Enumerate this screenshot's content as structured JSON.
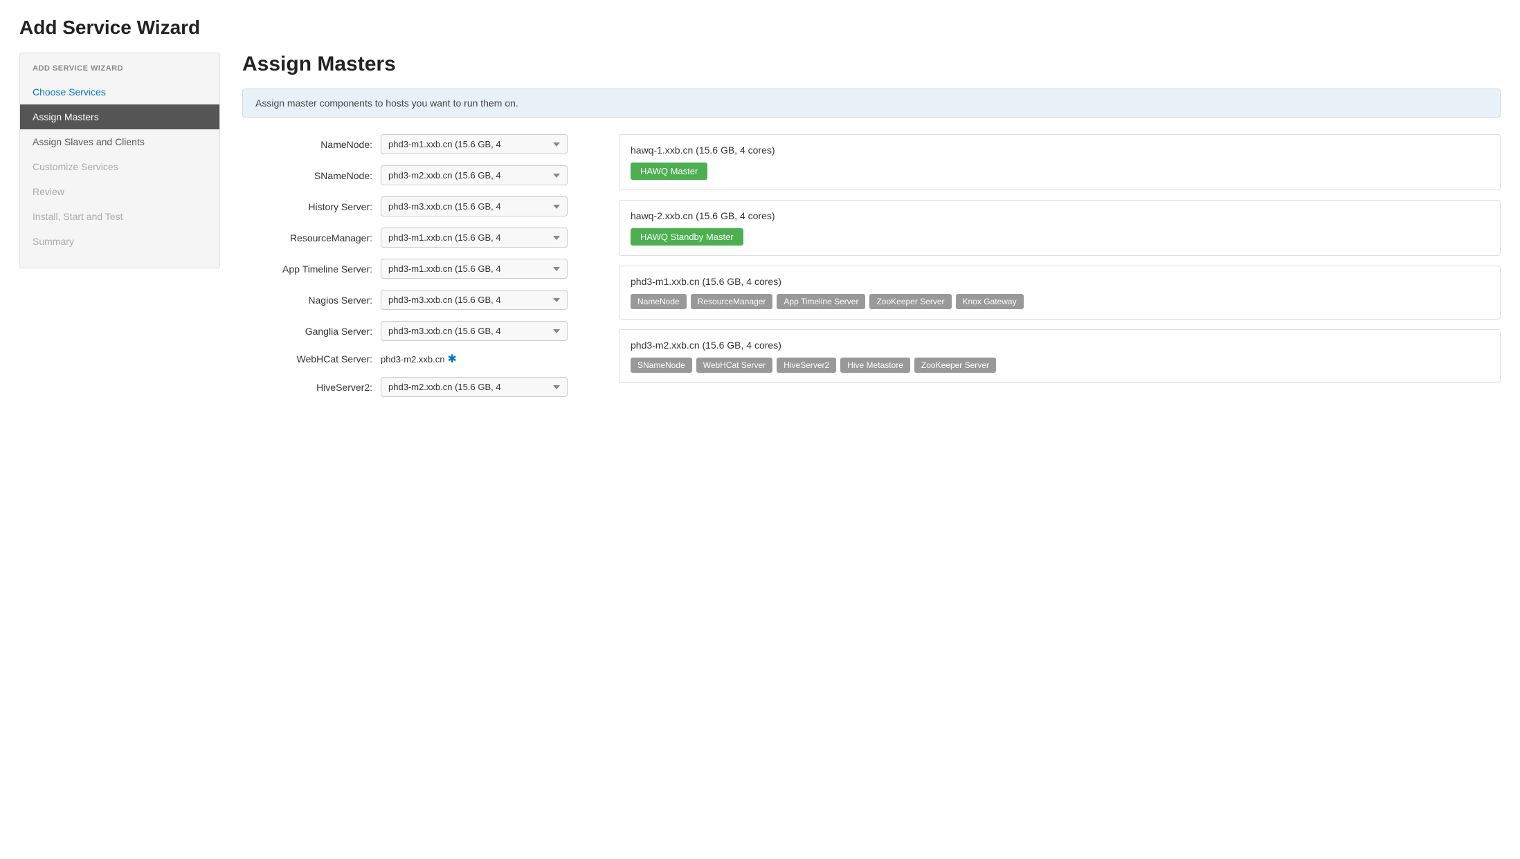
{
  "page": {
    "title": "Add Service Wizard"
  },
  "sidebar": {
    "header": "ADD SERVICE WIZARD",
    "items": [
      {
        "id": "choose-services",
        "label": "Choose Services",
        "state": "link"
      },
      {
        "id": "assign-masters",
        "label": "Assign Masters",
        "state": "active"
      },
      {
        "id": "assign-slaves",
        "label": "Assign Slaves and Clients",
        "state": "normal"
      },
      {
        "id": "customize-services",
        "label": "Customize Services",
        "state": "normal"
      },
      {
        "id": "review",
        "label": "Review",
        "state": "normal"
      },
      {
        "id": "install-start-test",
        "label": "Install, Start and Test",
        "state": "normal"
      },
      {
        "id": "summary",
        "label": "Summary",
        "state": "normal"
      }
    ]
  },
  "content": {
    "section_title": "Assign Masters",
    "info_banner": "Assign master components to hosts you want to run them on.",
    "form_rows": [
      {
        "id": "namenode",
        "label": "NameNode:",
        "type": "select",
        "value": "phd3-m1.xxb.cn (15.6 GB, 4"
      },
      {
        "id": "snamenode",
        "label": "SNameNode:",
        "type": "select",
        "value": "phd3-m2.xxb.cn (15.6 GB, 4"
      },
      {
        "id": "history-server",
        "label": "History Server:",
        "type": "select",
        "value": "phd3-m3.xxb.cn (15.6 GB, 4"
      },
      {
        "id": "resource-manager",
        "label": "ResourceManager:",
        "type": "select",
        "value": "phd3-m1.xxb.cn (15.6 GB, 4"
      },
      {
        "id": "app-timeline-server",
        "label": "App Timeline Server:",
        "type": "select",
        "value": "phd3-m1.xxb.cn (15.6 GB, 4"
      },
      {
        "id": "nagios-server",
        "label": "Nagios Server:",
        "type": "select",
        "value": "phd3-m3.xxb.cn (15.6 GB, 4"
      },
      {
        "id": "ganglia-server",
        "label": "Ganglia Server:",
        "type": "select",
        "value": "phd3-m3.xxb.cn (15.6 GB, 4"
      },
      {
        "id": "webhcat-server",
        "label": "WebHCat Server:",
        "type": "static",
        "value": "phd3-m2.xxb.cn"
      },
      {
        "id": "hiveserver2",
        "label": "HiveServer2:",
        "type": "select",
        "value": "phd3-m2.xxb.cn (15.6 GB, 4"
      }
    ],
    "host_cards": [
      {
        "id": "hawq-1",
        "host_name": "hawq-1.xxb.cn (15.6 GB, 4 cores)",
        "tags": [
          {
            "label": "HAWQ Master",
            "style": "green"
          }
        ]
      },
      {
        "id": "hawq-2",
        "host_name": "hawq-2.xxb.cn (15.6 GB, 4 cores)",
        "tags": [
          {
            "label": "HAWQ Standby Master",
            "style": "green"
          }
        ]
      },
      {
        "id": "phd3-m1",
        "host_name": "phd3-m1.xxb.cn (15.6 GB, 4 cores)",
        "tags": [
          {
            "label": "NameNode",
            "style": "gray"
          },
          {
            "label": "ResourceManager",
            "style": "gray"
          },
          {
            "label": "App Timeline Server",
            "style": "gray"
          },
          {
            "label": "ZooKeeper Server",
            "style": "gray"
          },
          {
            "label": "Knox Gateway",
            "style": "gray"
          }
        ]
      },
      {
        "id": "phd3-m2",
        "host_name": "phd3-m2.xxb.cn (15.6 GB, 4 cores)",
        "tags": [
          {
            "label": "SNameNode",
            "style": "gray"
          },
          {
            "label": "WebHCat Server",
            "style": "gray"
          },
          {
            "label": "HiveServer2",
            "style": "gray"
          },
          {
            "label": "Hive Metastore",
            "style": "gray"
          },
          {
            "label": "ZooKeeper Server",
            "style": "gray"
          }
        ]
      }
    ]
  }
}
